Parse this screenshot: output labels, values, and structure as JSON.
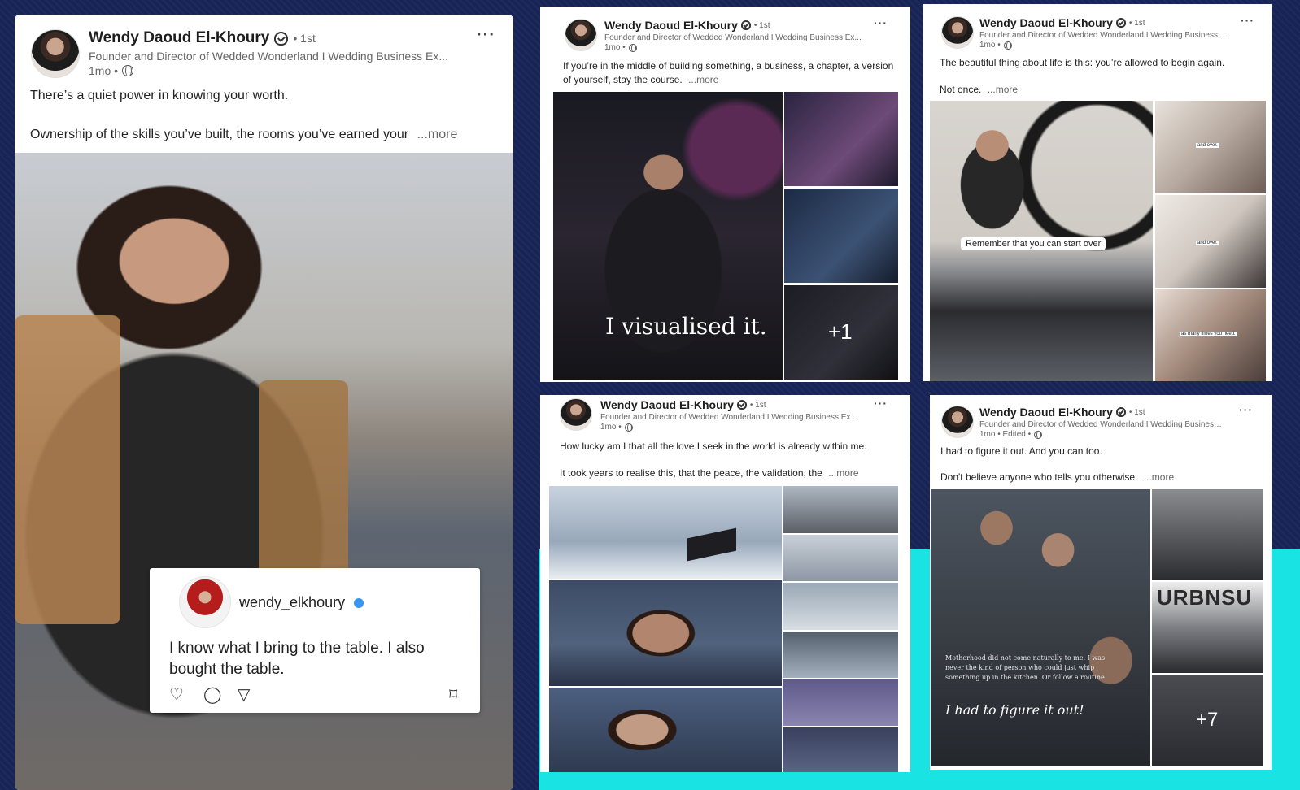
{
  "posts": [
    {
      "author": "Wendy Daoud El-Khoury",
      "degree": "• 1st",
      "headline": "Founder and Director of Wedded Wonderland I Wedding Business Ex...",
      "time": "1mo •",
      "line1": "There’s a quiet power in knowing your worth.",
      "line2": "Ownership of the skills you’ve built, the rooms you’ve earned your",
      "more": "...more",
      "ig": {
        "handle": "wendy_elkhoury",
        "quote": "I know what I bring to the table. I also bought the table."
      }
    },
    {
      "author": "Wendy Daoud El-Khoury",
      "degree": "• 1st",
      "headline": "Founder and Director of Wedded Wonderland I Wedding Business Ex...",
      "time": "1mo •",
      "line1": "If you’re in the middle of building something, a business, a chapter, a version",
      "line2": "of yourself, stay the course.",
      "more": "...more",
      "caption": "I visualised it.",
      "extra_count": "+1"
    },
    {
      "author": "Wendy Daoud El-Khoury",
      "degree": "• 1st",
      "headline": "Founder and Director of Wedded Wonderland I Wedding Business Ex...",
      "time": "1mo •",
      "line1": "The beautiful thing about life is this: you’re allowed to begin again.",
      "line2": "Not once.",
      "more": "...more",
      "caption": "Remember that you can start over",
      "small_captions": [
        "and over.",
        "and over.",
        "as many times you need."
      ]
    },
    {
      "author": "Wendy Daoud El-Khoury",
      "degree": "• 1st",
      "headline": "Founder and Director of Wedded Wonderland I Wedding Business Ex...",
      "time": "1mo •",
      "line1": "How lucky am I that all the love I seek in the world is already within me.",
      "line2": "It took years to realise this, that the peace, the validation, the",
      "more": "...more"
    },
    {
      "author": "Wendy Daoud El-Khoury",
      "degree": "• 1st",
      "headline": "Founder and Director of Wedded Wonderland I Wedding Business Ex...",
      "time": "1mo • Edited •",
      "line1": "I had to figure it out. And you can too.",
      "line2": "Don't believe anyone who tells you otherwise.",
      "more": "...more",
      "overlay_text": "Motherhood did not come naturally to me. I was never the kind of person who could just whip something up in the kitchen. Or follow a routine.",
      "script_text": "I had to figure it out!",
      "brand_text": "URBNSU",
      "extra_count": "+7"
    }
  ],
  "colors": {
    "background": "#182456",
    "accent_cyan": "#19e3e3",
    "ig_verified": "#3897f0"
  }
}
